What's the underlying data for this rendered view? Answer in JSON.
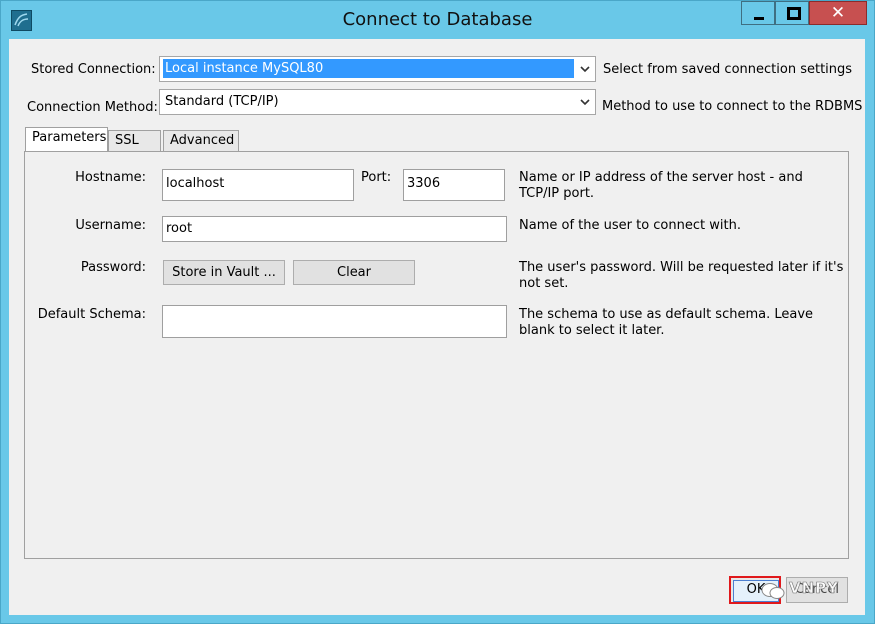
{
  "window": {
    "title": "Connect to Database",
    "close_glyph": "✕"
  },
  "stored_connection": {
    "label": "Stored Connection:",
    "value": "Local instance MySQL80",
    "hint": "Select from saved connection settings"
  },
  "connection_method": {
    "label": "Connection Method:",
    "value": "Standard (TCP/IP)",
    "hint": "Method to use to connect to the RDBMS"
  },
  "tabs": [
    {
      "label": "Parameters",
      "active": true
    },
    {
      "label": "SSL",
      "active": false
    },
    {
      "label": "Advanced",
      "active": false
    }
  ],
  "parameters": {
    "hostname": {
      "label": "Hostname:",
      "value": "localhost"
    },
    "port": {
      "label": "Port:",
      "value": "3306"
    },
    "hostname_hint_line1": "Name or IP address of the server host - and",
    "hostname_hint_line2": "TCP/IP port.",
    "username": {
      "label": "Username:",
      "value": "root",
      "hint": "Name of the user to connect with."
    },
    "password": {
      "label": "Password:",
      "store_button": "Store in Vault ...",
      "clear_button": "Clear",
      "hint_line1": "The user's password. Will be requested later if it's",
      "hint_line2": "not set."
    },
    "default_schema": {
      "label": "Default Schema:",
      "value": "",
      "hint_line1": "The schema to use as default schema. Leave",
      "hint_line2": "blank to select it later."
    }
  },
  "footer": {
    "ok_label": "OK",
    "cancel_label": "Cancel",
    "watermark": "VNPY"
  },
  "colors": {
    "titlebar": "#69c8e8",
    "close": "#c75050",
    "highlight": "#e0181b",
    "selection": "#3399ff"
  }
}
